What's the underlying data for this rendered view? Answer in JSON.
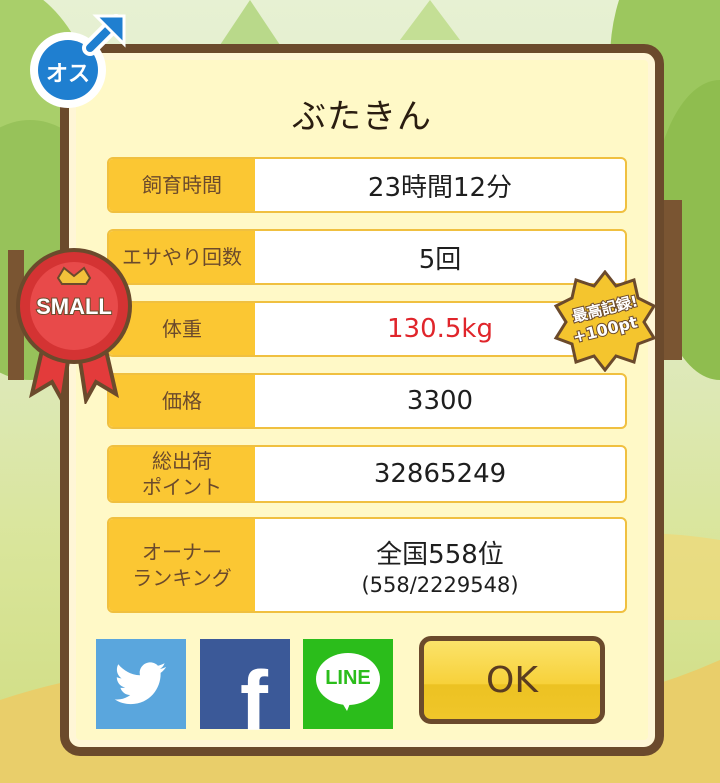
{
  "header": {
    "gender_label": "オス",
    "name": "ぶたきん"
  },
  "badges": {
    "size_badge": "SMALL",
    "record_line1": "最高記録!",
    "record_line2": "+100pt"
  },
  "stats": [
    {
      "label": "飼育時間",
      "value": "23時間12分"
    },
    {
      "label": "エサやり回数",
      "value": "5回"
    },
    {
      "label": "体重",
      "value": "130.5kg"
    },
    {
      "label": "価格",
      "value": "3300"
    },
    {
      "label": "総出荷\nポイント",
      "value": "32865249"
    },
    {
      "label": "オーナー\nランキング",
      "value": "全国558位",
      "sub": "(558/2229548)"
    }
  ],
  "share": {
    "line_label": "LINE",
    "facebook_glyph": "f"
  },
  "actions": {
    "ok_label": "OK"
  },
  "colors": {
    "weight_highlight": "#e0252b",
    "label_bg": "#fbc733",
    "frame": "#6b4a2c"
  }
}
